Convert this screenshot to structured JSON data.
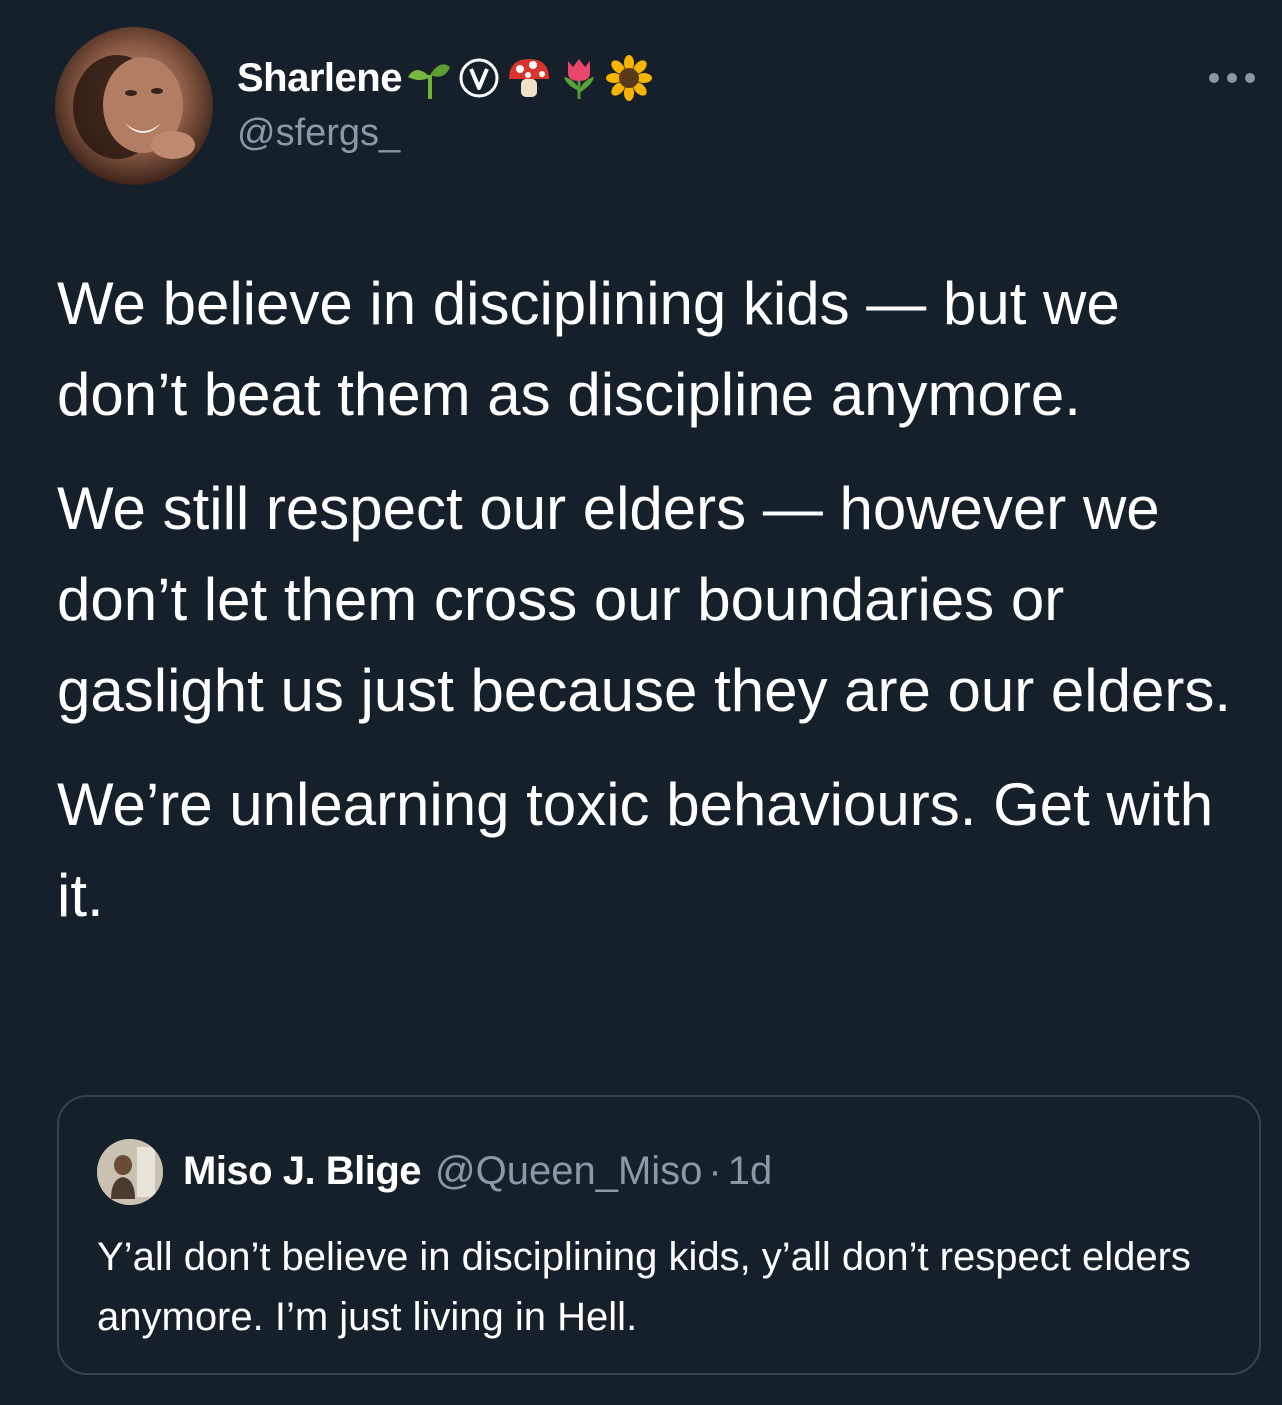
{
  "author": {
    "display_name": "Sharlene",
    "name_emojis": [
      "seedling-icon",
      "v-badge-icon",
      "mushroom-icon",
      "tulip-icon",
      "sunflower-icon"
    ],
    "handle": "@sfergs_"
  },
  "tweet": {
    "paragraphs": [
      "We believe in disciplining kids — but we don’t beat them as discipline anymore.",
      "We still respect our elders — however we don’t let them cross our boundaries or gaslight us just because they are our elders.",
      "We’re unlearning toxic behaviours. Get with it."
    ]
  },
  "quoted_tweet": {
    "display_name": "Miso J. Blige",
    "handle": "@Queen_Miso",
    "separator": "·",
    "time": "1d",
    "text": "Y’all don’t believe in disciplining kids, y’all don’t respect elders anymore. I’m just living in Hell."
  },
  "colors": {
    "background": "#15202b",
    "text_primary": "#ffffff",
    "text_secondary": "#8b98a5",
    "border": "#38444d"
  }
}
